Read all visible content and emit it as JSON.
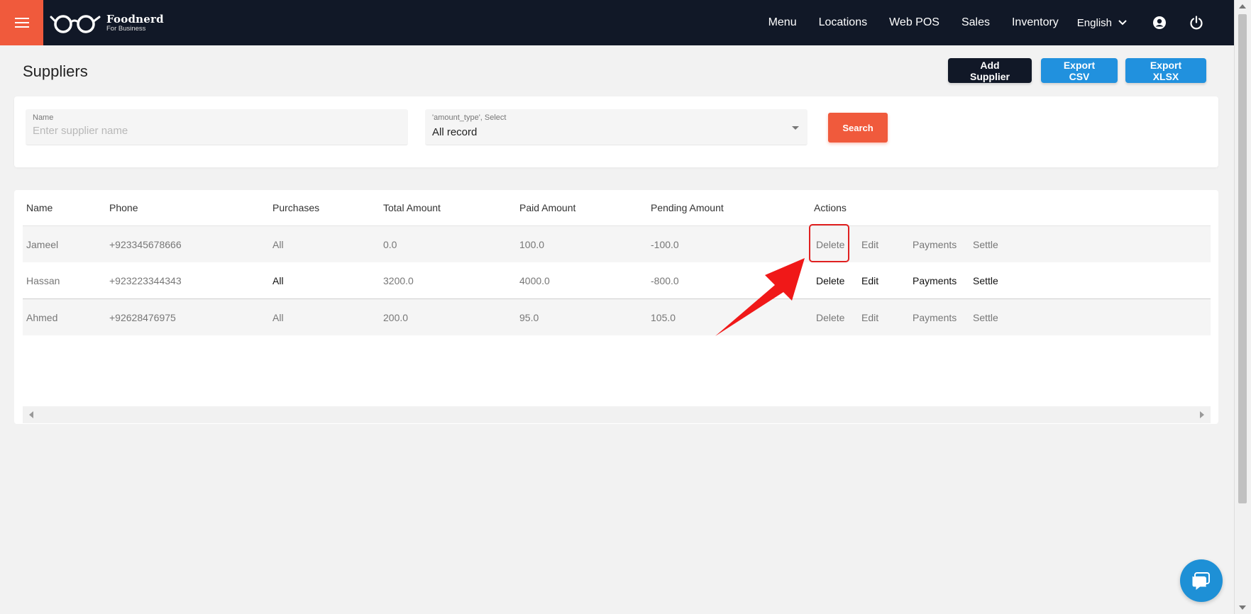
{
  "brand": {
    "name": "Foodnerd",
    "tagline": "For Business"
  },
  "nav": {
    "links": [
      "Menu",
      "Locations",
      "Web POS",
      "Sales",
      "Inventory"
    ],
    "language": "English"
  },
  "page": {
    "title": "Suppliers",
    "buttons": {
      "add": "Add Supplier",
      "export_csv": "Export CSV",
      "export_xlsx": "Export XLSX"
    }
  },
  "filters": {
    "name_label": "Name",
    "name_placeholder": "Enter supplier name",
    "type_label": "'amount_type', Select",
    "type_value": "All record",
    "search_label": "Search"
  },
  "table": {
    "headers": [
      "Name",
      "Phone",
      "Purchases",
      "Total Amount",
      "Paid Amount",
      "Pending Amount",
      "Actions"
    ],
    "rows": [
      {
        "name": "Jameel",
        "phone": "+923345678666",
        "purchases": "All",
        "total": "0.0",
        "paid": "100.0",
        "pending": "-100.0"
      },
      {
        "name": "Hassan",
        "phone": "+923223344343",
        "purchases": "All",
        "total": "3200.0",
        "paid": "4000.0",
        "pending": "-800.0"
      },
      {
        "name": "Ahmed",
        "phone": "+92628476975",
        "purchases": "All",
        "total": "200.0",
        "paid": "95.0",
        "pending": "105.0"
      }
    ],
    "actions": {
      "delete": "Delete",
      "edit": "Edit",
      "payments": "Payments",
      "settle": "Settle"
    }
  },
  "colors": {
    "nav_bg": "#111827",
    "accent": "#f05a3c",
    "primary": "#2191de",
    "highlight": "#e02020"
  },
  "icons": [
    "menu-icon",
    "glasses-logo-icon",
    "chevron-down-icon",
    "account-icon",
    "power-icon",
    "chat-icon"
  ]
}
